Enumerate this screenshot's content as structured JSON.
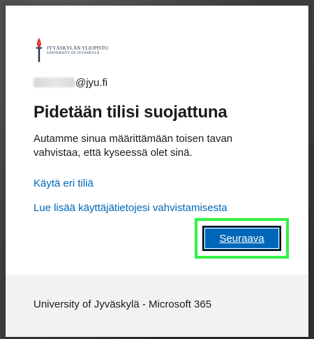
{
  "org": {
    "logo_line1": "JYVÄSKYLÄN YLIOPISTO",
    "logo_line2": "UNIVERSITY OF JYVÄSKYLÄ"
  },
  "account": {
    "domain": "@jyu.fi"
  },
  "page": {
    "title": "Pidetään tilisi suojattuna",
    "description": "Autamme sinua määrittämään toisen tavan vahvistaa, että kyseessä olet sinä."
  },
  "links": {
    "use_other_account": "Käytä eri tiliä",
    "learn_more": "Lue lisää käyttäjätietojesi vahvistamisesta"
  },
  "actions": {
    "next_label": "Seuraava"
  },
  "footer": {
    "text": "University of Jyväskylä - Microsoft 365"
  },
  "colors": {
    "link": "#0067b8",
    "primary_button": "#0067b8",
    "highlight": "#33f044",
    "brand_navy": "#23344d",
    "brand_red": "#d3302f",
    "footer_bg": "#f2f2f2"
  },
  "icons": {
    "logo": "torch-logo-icon"
  }
}
